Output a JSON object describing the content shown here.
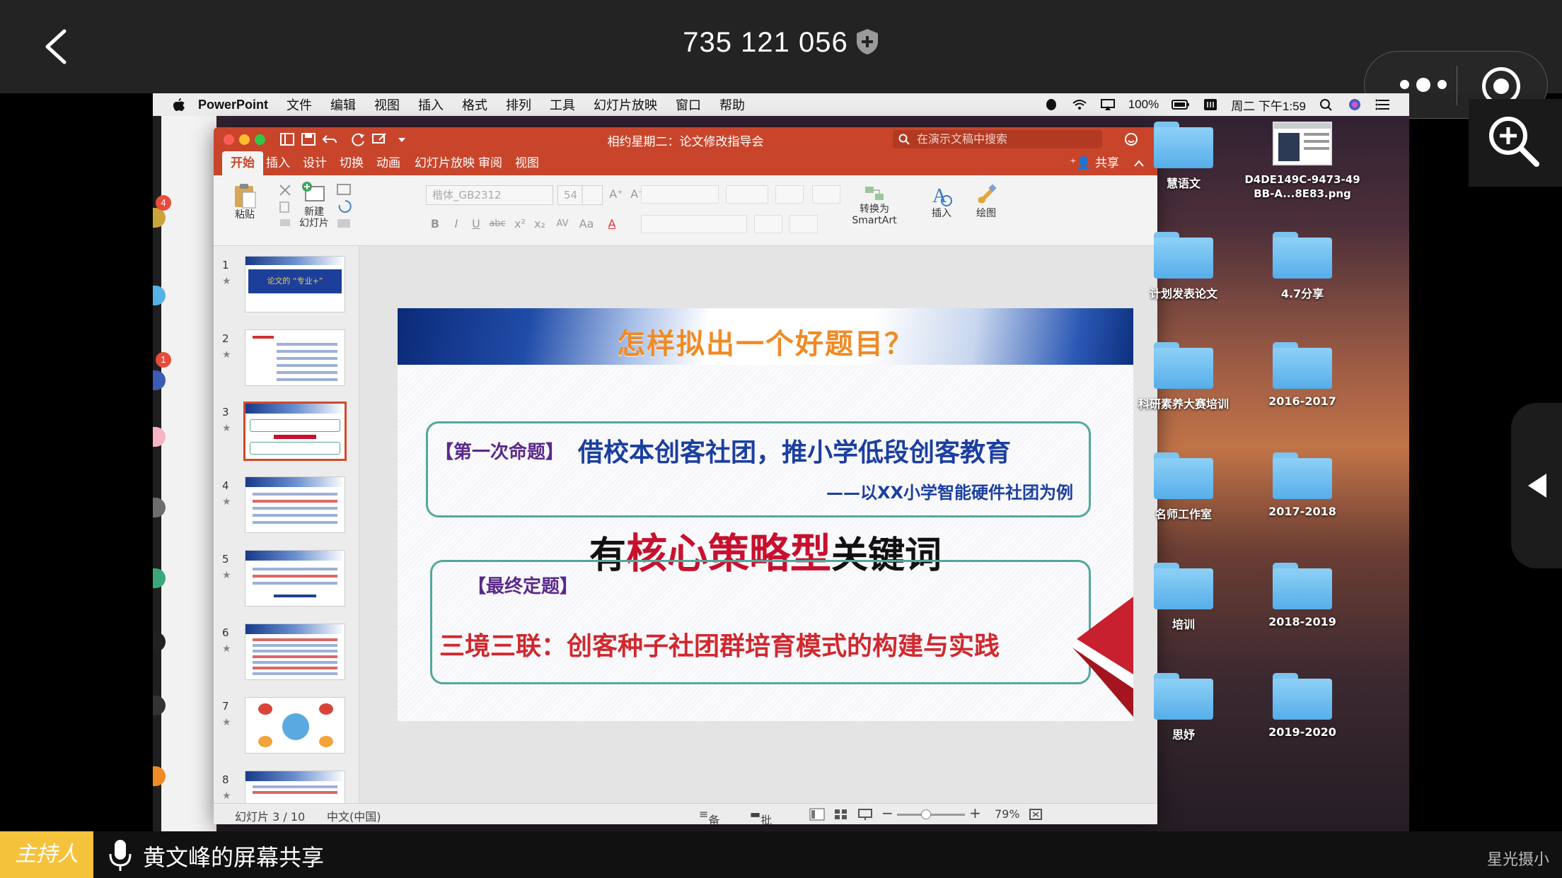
{
  "meeting": {
    "id": "735 121 056",
    "host_tag": "主持人",
    "share_label": "黄文峰的屏幕共享",
    "watermark": "星光摄小"
  },
  "mac_menubar": {
    "app": "PowerPoint",
    "menus": [
      "文件",
      "编辑",
      "视图",
      "插入",
      "格式",
      "排列",
      "工具",
      "幻灯片放映",
      "窗口",
      "帮助"
    ],
    "battery": "100%",
    "datetime": "周二 下午1:59"
  },
  "ppt": {
    "doc_title": "相约星期二：论文修改指导会",
    "search_placeholder": "在演示文稿中搜索",
    "tabs": [
      "开始",
      "插入",
      "设计",
      "切换",
      "动画",
      "幻灯片放映",
      "审阅",
      "视图"
    ],
    "share": "共享",
    "ribbon": {
      "paste": "粘贴",
      "new_slide_1": "新建",
      "new_slide_2": "幻灯片",
      "font": "楷体_GB2312",
      "size": "54",
      "smartart_1": "转换为",
      "smartart_2": "SmartArt",
      "insert": "插入",
      "draw": "绘图"
    },
    "thumbnails": [
      {
        "num": "1",
        "text": "论文的 “专业+”"
      },
      {
        "num": "2"
      },
      {
        "num": "3"
      },
      {
        "num": "4"
      },
      {
        "num": "5"
      },
      {
        "num": "6"
      },
      {
        "num": "7"
      },
      {
        "num": "8"
      }
    ],
    "slide": {
      "title": "怎样拟出一个好题目？",
      "box1_label": "【第一次命题】",
      "box1_main": "借校本创客社团，推小学低段创客教育",
      "box1_sub": "——以XX小学智能硬件社团为例",
      "key_prefix": "有",
      "key_red": "核心策略型",
      "key_suffix": "关键词",
      "box2_label": "【最终定题】",
      "box2_main": "三境三联：创客种子社团群培育模式的构建与实践"
    },
    "status": {
      "slide_pos": "幻灯片 3 / 10",
      "lang": "中文(中国)",
      "notes": "备注",
      "comments": "批注",
      "zoom": "79%"
    }
  },
  "desktop_icons": [
    {
      "label": "慧语文",
      "kind": "folder"
    },
    {
      "label": "D4DE149C-9473-49BB-A...8E83.png",
      "kind": "png"
    },
    {
      "label": "计划发表论文",
      "kind": "folder"
    },
    {
      "label": "4.7分享",
      "kind": "folder"
    },
    {
      "label": "科研素养大赛培训",
      "kind": "folder"
    },
    {
      "label": "2016-2017",
      "kind": "folder"
    },
    {
      "label": "名师工作室",
      "kind": "folder"
    },
    {
      "label": "2017-2018",
      "kind": "folder"
    },
    {
      "label": "培训",
      "kind": "folder"
    },
    {
      "label": "2018-2019",
      "kind": "folder"
    },
    {
      "label": "思妤",
      "kind": "folder"
    },
    {
      "label": "2019-2020",
      "kind": "folder"
    }
  ],
  "left_badges": [
    "4",
    "1"
  ]
}
